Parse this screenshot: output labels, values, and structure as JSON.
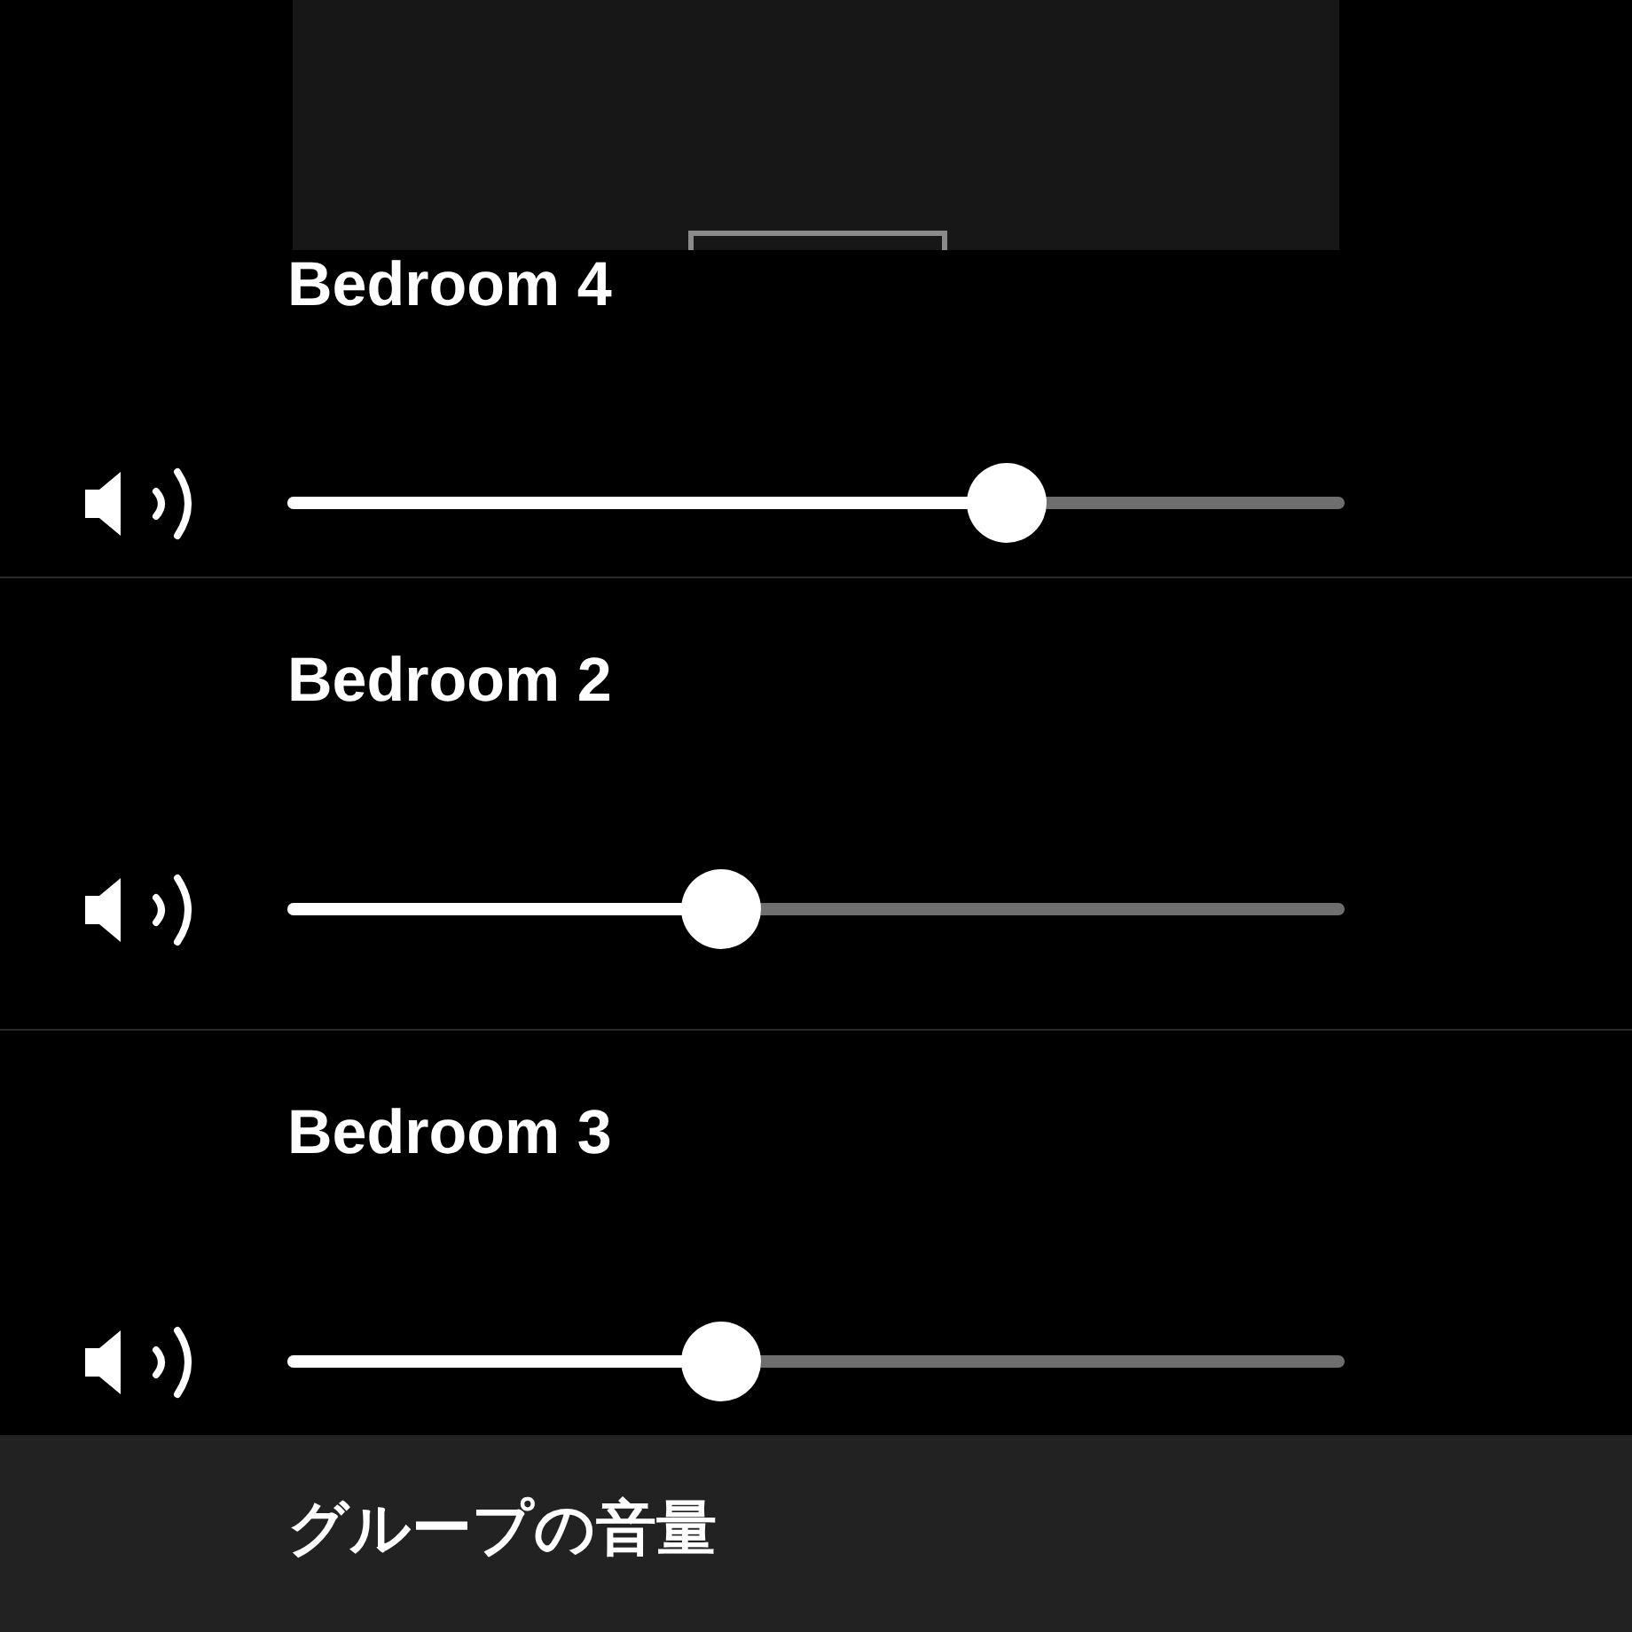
{
  "rooms": [
    {
      "name": "Bedroom 4",
      "level": 0.68
    },
    {
      "name": "Bedroom 2",
      "level": 0.41
    },
    {
      "name": "Bedroom 3",
      "level": 0.41
    }
  ],
  "footer": {
    "title": "グループの音量"
  }
}
